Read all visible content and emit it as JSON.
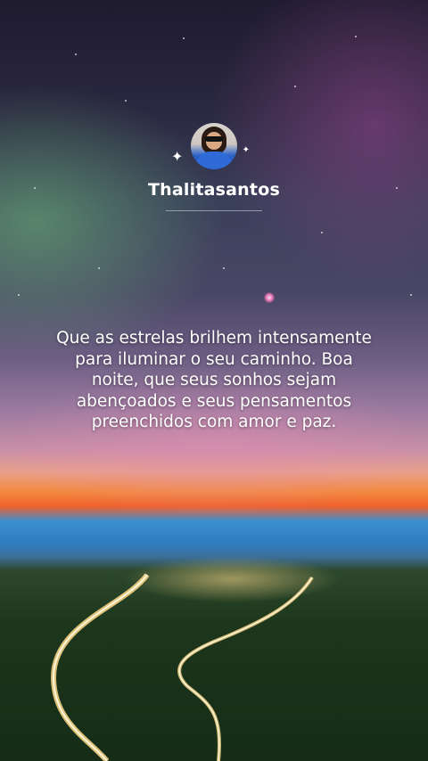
{
  "post": {
    "author": {
      "username": "Thalitasantos",
      "avatar_icon": "user-avatar-photo",
      "sparkle_icon": "sparkle-icon"
    },
    "message": "Que as estrelas brilhem intensamente para iluminar o seu caminho. Boa noite, que seus sonhos sejam abençoados e seus pensamentos preenchidos com amor e paz."
  },
  "colors": {
    "text": "#ffffff",
    "sky_top": "#1e1b2f",
    "sunset_orange": "#f3893e",
    "sea_blue": "#2f7cc0",
    "forest_green": "#1f3a1e"
  }
}
